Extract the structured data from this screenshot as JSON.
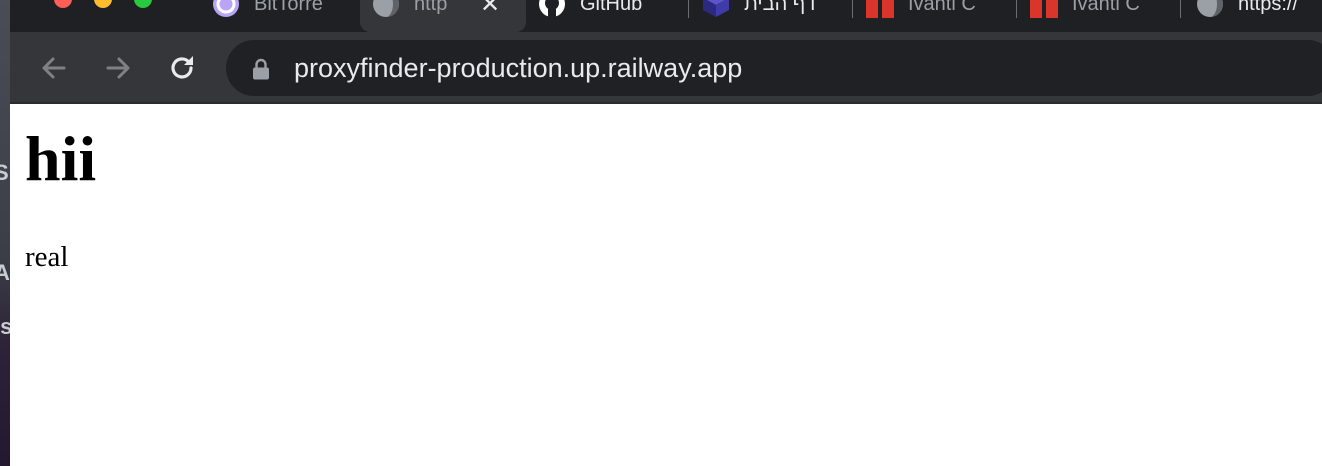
{
  "browser": {
    "tabs": [
      {
        "title": "BitTorre",
        "icon": "bittorrent-icon",
        "active": false
      },
      {
        "title": "http",
        "icon": "globe-icon",
        "active": true
      },
      {
        "title": "GitHub",
        "icon": "github-icon",
        "active": false
      },
      {
        "title": "דף הבית",
        "icon": "cube-icon",
        "active": false
      },
      {
        "title": "Ivanti C",
        "icon": "ivanti-icon",
        "active": false
      },
      {
        "title": "Ivanti C",
        "icon": "ivanti-icon",
        "active": false
      },
      {
        "title": "https://",
        "icon": "globe-icon",
        "active": false
      }
    ],
    "address_bar": {
      "url": "proxyfinder-production.up.railway.app",
      "secure_icon": "lock-icon"
    },
    "colors": {
      "tabstrip": "#1f2023",
      "toolbar": "#35363a",
      "omnibox": "#202124",
      "text": "#e8eaed"
    }
  },
  "page": {
    "heading": "hii",
    "paragraph": "real"
  },
  "desktop": {
    "edge_letters": [
      "S",
      "A",
      "Is"
    ]
  }
}
